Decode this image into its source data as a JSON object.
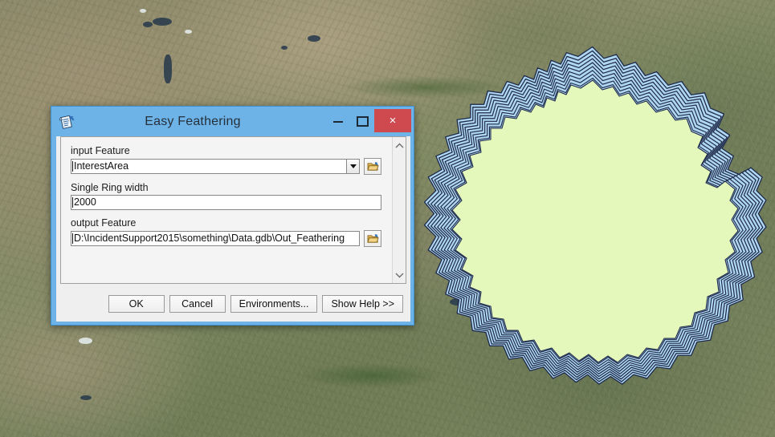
{
  "window": {
    "title": "Easy Feathering",
    "title_icon": "script-tool-icon",
    "minimize_label": "Minimize",
    "maximize_label": "Maximize",
    "close_label": "×",
    "accent_color": "#6db3e8",
    "close_color": "#cf4a4f"
  },
  "parameters": {
    "input_feature": {
      "label": "input Feature",
      "value": "InterestArea",
      "browse_icon": "open-folder-icon",
      "dropdown_icon": "chevron-down-icon"
    },
    "ring_width": {
      "label": "Single Ring width",
      "value": "2000"
    },
    "output_feature": {
      "label": "output Feature",
      "value": "D:\\IncidentSupport2015\\something\\Data.gdb\\Out_Feathering",
      "browse_icon": "open-folder-icon"
    },
    "scrollbar": {
      "up_icon": "chevron-up-icon",
      "down_icon": "chevron-down-icon"
    }
  },
  "buttons": {
    "ok": "OK",
    "cancel": "Cancel",
    "environments": "Environments...",
    "show_help": "Show Help >>"
  },
  "map": {
    "layer_name": "satellite-basemap",
    "feature_fill_color": "#e4f8bb",
    "feather_ring_color": "#aed6f1",
    "feather_outline_color": "#1f2a4a",
    "feather_ring_count": 9
  }
}
